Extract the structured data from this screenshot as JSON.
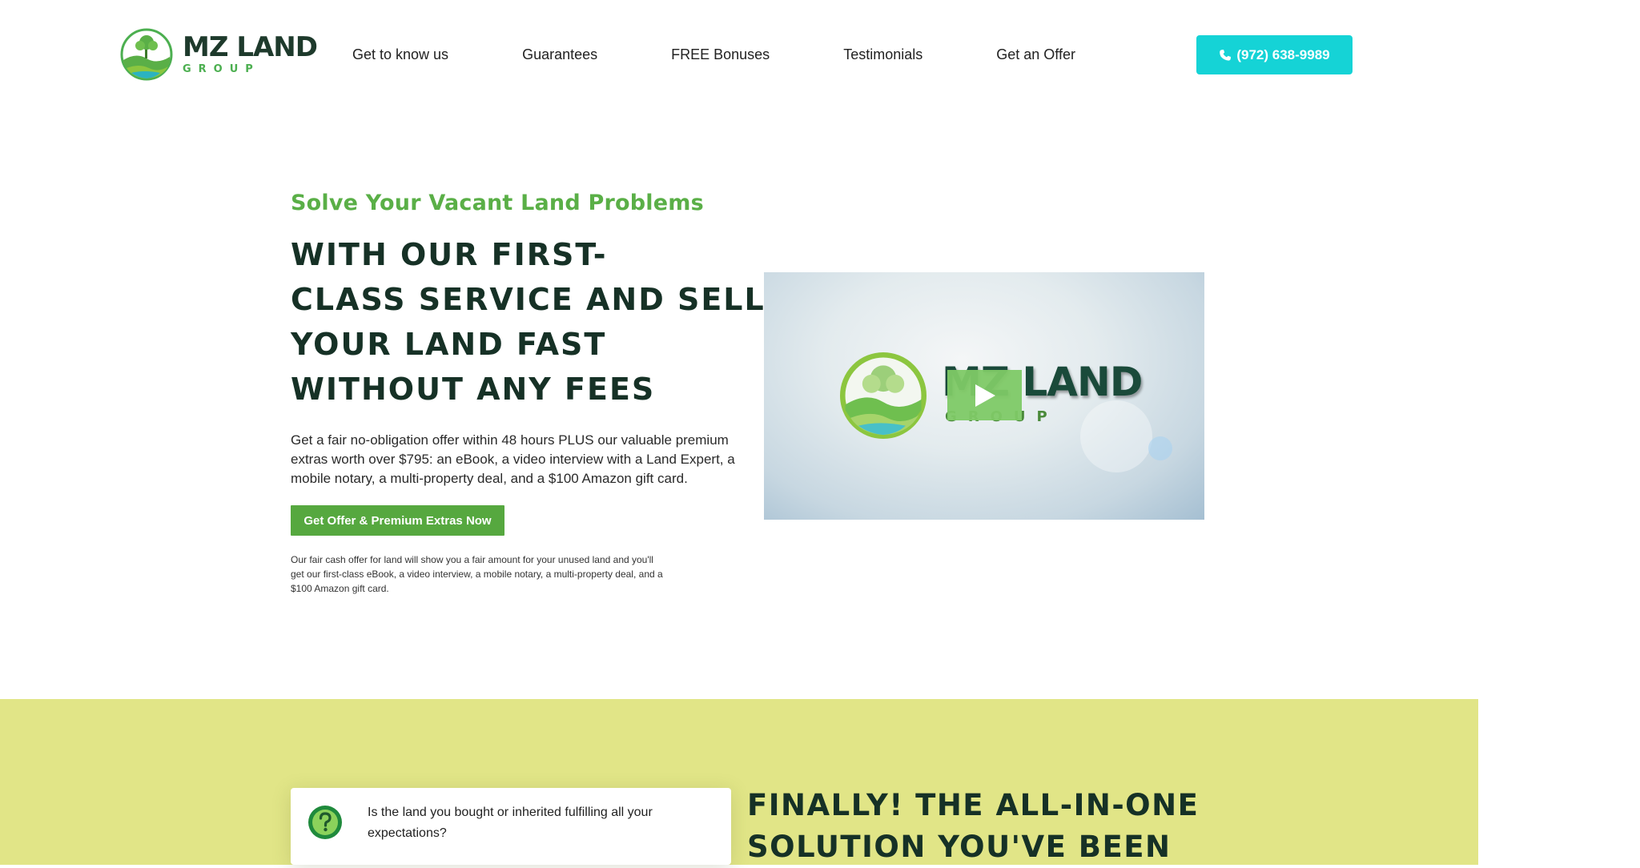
{
  "header": {
    "logo": {
      "name": "MZ LAND",
      "sub": "GROUP",
      "icon": "tree-globe-logo-icon"
    },
    "nav": [
      {
        "label": "Get to know us"
      },
      {
        "label": "Guarantees"
      },
      {
        "label": "FREE Bonuses"
      },
      {
        "label": "Testimonials"
      },
      {
        "label": "Get an Offer"
      }
    ],
    "phone": {
      "label": "(972) 638-9989",
      "icon": "phone-icon"
    }
  },
  "hero": {
    "subtitle": "Solve Your Vacant Land Problems",
    "title_lines": [
      "WITH OUR FIRST-",
      "CLASS SERVICE AND SELL",
      "YOUR LAND FAST",
      "WITHOUT ANY FEES"
    ],
    "description": "Get a fair no-obligation offer within 48 hours PLUS our valuable premium extras worth over $795: an eBook, a video interview with a Land Expert, a mobile notary, a multi-property deal, and a $100 Amazon gift card.",
    "cta_label": "Get Offer & Premium Extras Now",
    "fine_print": "Our fair cash offer for land will show you a fair amount for your unused land and you'll get our first-class eBook, a video interview, a mobile notary, a multi-property deal, and a $100 Amazon gift card.",
    "video": {
      "logo_text": "MZ LAND",
      "logo_sub": "GROUP",
      "play_icon": "play-icon"
    }
  },
  "band": {
    "question": "Is the land you bought or inherited fulfilling all your expectations?",
    "question_icon": "question-circle-icon",
    "heading_lines": [
      "FINALLY! THE ALL-IN-ONE",
      "SOLUTION YOU'VE BEEN"
    ]
  },
  "colors": {
    "accent_cyan": "#15d3d6",
    "brand_green": "#56a83f",
    "dark_green": "#163126",
    "band_yellow": "#e1e587"
  }
}
